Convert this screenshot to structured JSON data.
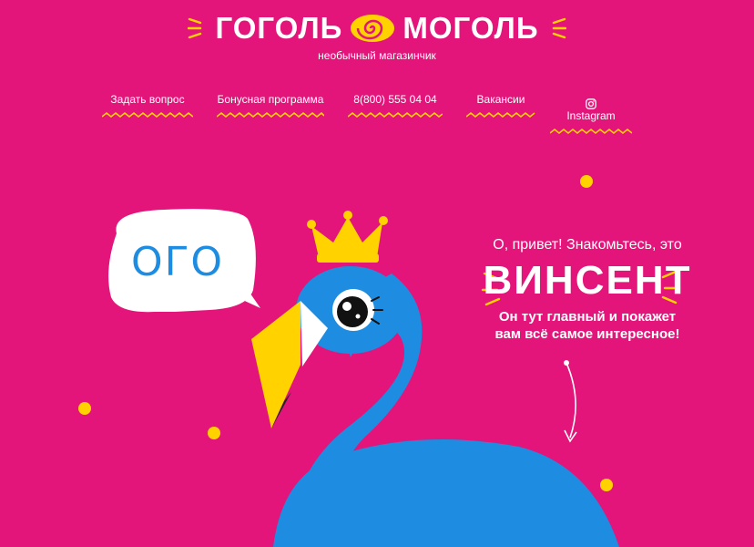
{
  "brand": {
    "name_left": "ГОГОЛЬ",
    "name_right": "МОГОЛЬ",
    "tagline": "необычный магазинчик"
  },
  "nav": {
    "items": [
      {
        "label": "Задать вопрос"
      },
      {
        "label": "Бонусная программа"
      },
      {
        "label": "8(800) 555 04 04"
      },
      {
        "label": "Вакансии"
      },
      {
        "label": "Instagram"
      }
    ]
  },
  "speech_bubble": {
    "text": "ОГО"
  },
  "greeting": {
    "intro": "О, привет! Знакомьтесь, это",
    "name": "ВИНСЕНТ",
    "description_line1": "Он тут главный и покажет",
    "description_line2": "вам всё самое интересное!"
  },
  "colors": {
    "background": "#e3157a",
    "accent_yellow": "#ffd200",
    "flamingo_blue": "#1e8ce0",
    "text": "#ffffff"
  }
}
